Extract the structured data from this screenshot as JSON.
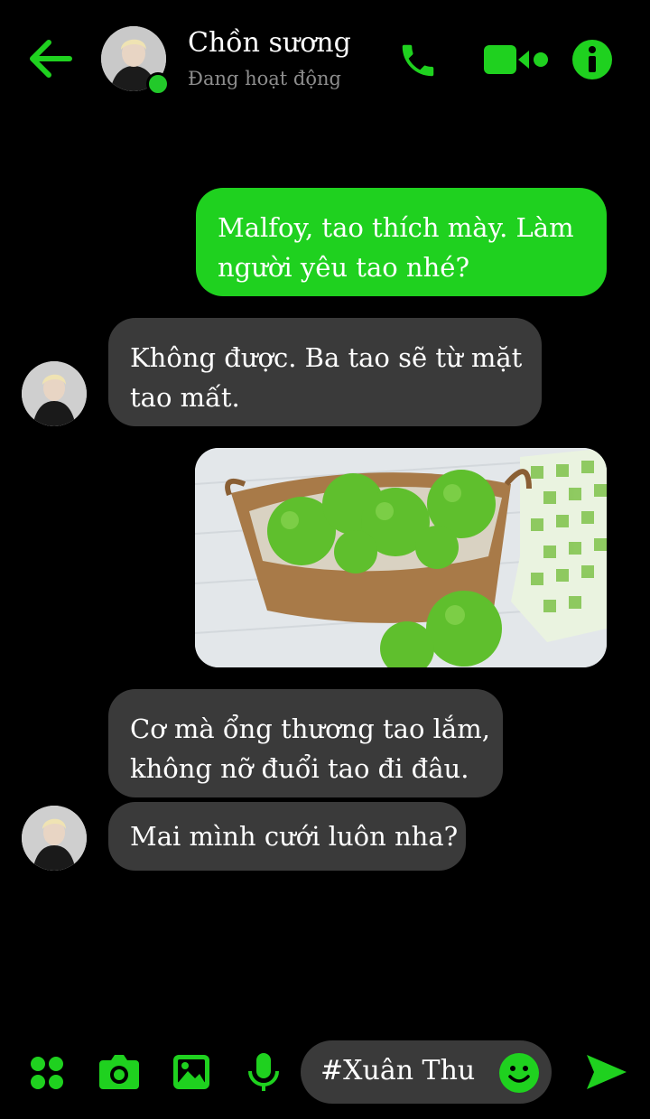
{
  "header": {
    "contact_name": "Chồn sương",
    "status": "Đang hoạt động"
  },
  "messages": [
    {
      "side": "outgoing",
      "lines": [
        "Malfoy, tao thích mày. Làm",
        "người yêu tao nhé?"
      ]
    },
    {
      "side": "incoming",
      "lines": [
        "Không được. Ba tao sẽ từ mặt",
        "tao mất."
      ]
    },
    {
      "side": "outgoing",
      "type": "image",
      "image": "green-apples-in-basket"
    },
    {
      "side": "incoming",
      "lines": [
        "Cơ mà ổng thương tao lắm,",
        "không nỡ đuổi tao đi đâu."
      ]
    },
    {
      "side": "incoming",
      "lines": [
        "Mai mình cưới luôn nha?"
      ]
    }
  ],
  "composer": {
    "input_value": "#Xuân Thu"
  },
  "icons": {
    "back": "back-arrow-icon",
    "call": "phone-icon",
    "video": "video-camera-icon",
    "info": "info-icon",
    "apps": "grid-dots-icon",
    "camera": "camera-icon",
    "gallery": "image-icon",
    "mic": "microphone-icon",
    "emoji": "smiley-icon",
    "send": "send-icon"
  },
  "colors": {
    "accent": "#1fd11f",
    "incoming_bubble": "#3a3a3a",
    "background": "#000000",
    "online": "#22c92a"
  }
}
